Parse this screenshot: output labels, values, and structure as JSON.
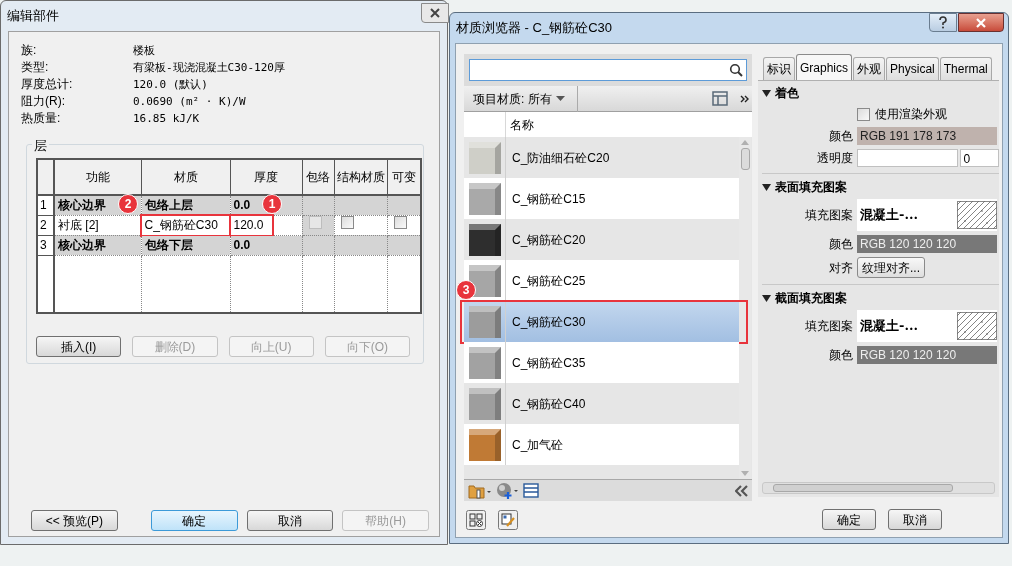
{
  "edit_assembly": {
    "title": "编辑部件",
    "properties": [
      {
        "label": "族:",
        "value": "楼板"
      },
      {
        "label": "类型:",
        "value": "有梁板-现浇混凝土C30-120厚"
      },
      {
        "label": "厚度总计:",
        "value": "120.0 (默认)"
      },
      {
        "label": "阻力(R):",
        "value": "0.0690 (m² · K)/W"
      },
      {
        "label": "热质量:",
        "value": "16.85 kJ/K"
      }
    ],
    "layers": {
      "title": "层",
      "columns": [
        "功能",
        "材质",
        "厚度",
        "包络",
        "结构材质",
        "可变"
      ],
      "rows": [
        {
          "kind": "boundary",
          "number": "1",
          "function": "核心边界",
          "material": "包络上层",
          "thickness": "0.0"
        },
        {
          "kind": "layer",
          "number": "2",
          "function": "衬底 [2]",
          "material": "C_钢筋砼C30",
          "thickness": "120.0",
          "material_badge": "2",
          "thickness_badge": "1",
          "wrap": {
            "checked": false,
            "disabled": true
          },
          "structural_material": {
            "checked": false,
            "disabled": false
          },
          "variable": {
            "checked": false,
            "disabled": false
          }
        },
        {
          "kind": "boundary",
          "number": "3",
          "function": "核心边界",
          "material": "包络下层",
          "thickness": "0.0"
        }
      ],
      "buttons": [
        {
          "label": "插入(I)",
          "disabled": false
        },
        {
          "label": "删除(D)",
          "disabled": true
        },
        {
          "label": "向上(U)",
          "disabled": true
        },
        {
          "label": "向下(O)",
          "disabled": true
        }
      ]
    },
    "buttons": [
      {
        "label": "<< 预览(P)",
        "disabled": false,
        "default": false
      },
      {
        "label": "确定",
        "disabled": false,
        "default": true
      },
      {
        "label": "取消",
        "disabled": false,
        "default": false
      },
      {
        "label": "帮助(H)",
        "disabled": true,
        "default": false
      }
    ]
  },
  "material_browser": {
    "title": "材质浏览器 - C_钢筋砼C30",
    "filter": "项目材质: 所有",
    "list_header": "名称",
    "materials": [
      {
        "name": "C_防油细石砼C20",
        "color": "#cfcfc8",
        "selected": false
      },
      {
        "name": "C_钢筋砼C15",
        "color": "#a9a9a9",
        "selected": false
      },
      {
        "name": "C_钢筋砼C20",
        "color": "#2e2e2e",
        "selected": false
      },
      {
        "name": "C_钢筋砼C25",
        "color": "#a6a6a6",
        "selected": false
      },
      {
        "name": "C_钢筋砼C30",
        "color": "#9c9c9c",
        "selected": true,
        "badge": "3"
      },
      {
        "name": "C_钢筋砼C35",
        "color": "#a2a2a2",
        "selected": false
      },
      {
        "name": "C_钢筋砼C40",
        "color": "#9e9e9e",
        "selected": false
      },
      {
        "name": "C_加气砼",
        "color": "#c07a35",
        "selected": false
      }
    ],
    "tabs": [
      {
        "label": "标识",
        "selected": false
      },
      {
        "label": "Graphics",
        "selected": true
      },
      {
        "label": "外观",
        "selected": false
      },
      {
        "label": "Physical",
        "selected": false
      },
      {
        "label": "Thermal",
        "selected": false
      }
    ],
    "sections": [
      {
        "title": "着色",
        "expanded": true,
        "rows": [
          {
            "kind": "checkbox",
            "label": "使用渲染外观",
            "checked": false
          },
          {
            "kind": "color",
            "label": "颜色",
            "value": "RGB 191 178 173",
            "color": "#bfb2ad"
          },
          {
            "kind": "slider",
            "label": "透明度",
            "value": "0",
            "level": 0
          }
        ]
      },
      {
        "title": "表面填充图案",
        "expanded": true,
        "rows": [
          {
            "kind": "pattern",
            "label": "填充图案",
            "value": "混凝土-..."
          },
          {
            "kind": "color",
            "label": "颜色",
            "value": "RGB 120 120 120",
            "color": "#787878"
          },
          {
            "kind": "button",
            "label": "对齐",
            "value": "纹理对齐..."
          }
        ]
      },
      {
        "title": "截面填充图案",
        "expanded": true,
        "rows": [
          {
            "kind": "pattern",
            "label": "填充图案",
            "value": "混凝土-..."
          },
          {
            "kind": "color",
            "label": "颜色",
            "value": "RGB 120 120 120",
            "color": "#787878"
          }
        ]
      }
    ],
    "buttons": [
      {
        "label": "确定"
      },
      {
        "label": "取消"
      }
    ]
  }
}
